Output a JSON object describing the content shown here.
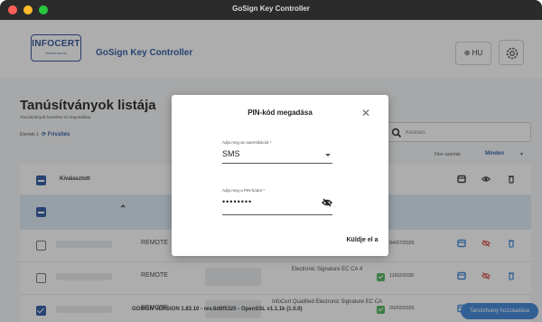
{
  "window": {
    "title": "GoSign Key Controller"
  },
  "header": {
    "logo_text": "INFOCERT",
    "logo_subtext": "TINEXTA GROUP",
    "app_name": "GoSign Key Controller",
    "lang_label": "⊕ HU"
  },
  "page": {
    "title": "Tanúsítványok listája",
    "subtitle": "Tanúsítványok kezelése és importálása",
    "counter": "Elemek 1",
    "refresh_label": "⟳ Frissítés",
    "search_placeholder": "Keresés",
    "filter_label": "Fitre szerinte",
    "filter_value": "Minden"
  },
  "table": {
    "select_all_label": "Kiválasztott",
    "rows": [
      {
        "type": "REMOTE",
        "issuer": "",
        "date": "04/07/2026",
        "checked": false
      },
      {
        "type": "REMOTE",
        "issuer": "Electronic Signature EC CA 4",
        "date": "11/02/2026",
        "checked": false
      },
      {
        "type": "REMOTE",
        "issuer": "InfoCert Qualified Electronic Signature EC CA",
        "date": "20/02/2026",
        "checked": true
      }
    ]
  },
  "footer": {
    "version": "GOSIGN VERSION 1.83.10 - rev.8d8f5320 - OpenSSL v1.1.1k (1.0.0)",
    "add_certificate": "Tanúsítvány hozzáadása"
  },
  "dialog": {
    "title": "PIN-kód megadása",
    "method_label": "Adja meg az autentikációt *",
    "method_value": "SMS",
    "pin_label": "Adja meg a PIN-kódot *",
    "pin_value": "••••••••",
    "submit_label": "Küldje el a"
  },
  "colors": {
    "brand_blue": "#1a4a9c",
    "accent_blue": "#2b7bd6",
    "status_green": "#3cae4a",
    "group_row": "#d8e8f3"
  }
}
